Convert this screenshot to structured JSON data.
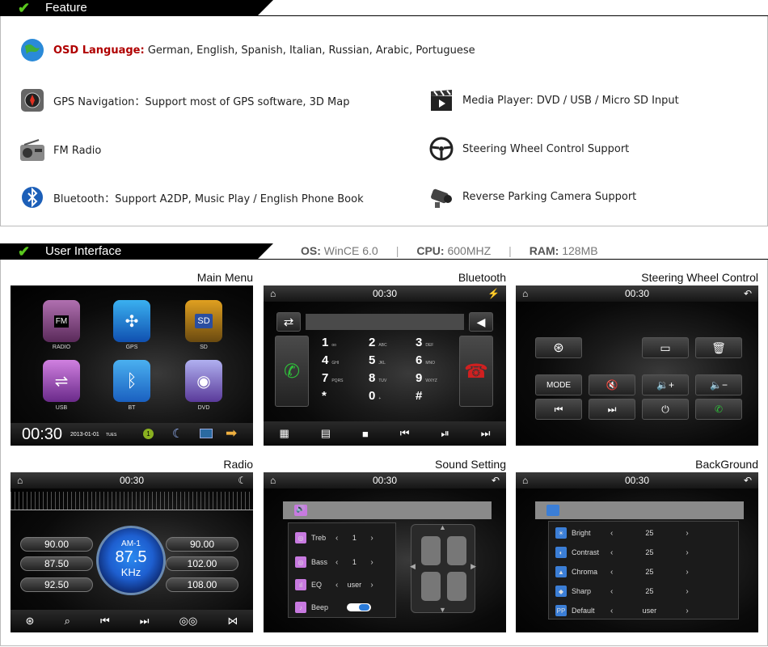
{
  "feature": {
    "title": "Feature",
    "items": {
      "osd_label": "OSD Language:",
      "osd_value": " German, English, Spanish, Italian, Russian, Arabic, Portuguese",
      "gps": "GPS Navigation：Support most of GPS software, 3D Map",
      "media": "Media Player: DVD / USB / Micro SD Input",
      "fm": "FM Radio",
      "swc": "Steering Wheel Control Support",
      "bt": "Bluetooth：Support A2DP, Music Play / English Phone Book",
      "cam": "Reverse Parking Camera Support"
    }
  },
  "ui": {
    "title": "User Interface",
    "os_label": "OS:",
    "os_value": "WinCE 6.0",
    "cpu_label": "CPU:",
    "cpu_value": "600MHZ",
    "ram_label": "RAM:",
    "ram_value": "128MB",
    "sep": "|"
  },
  "screens": {
    "main_menu": {
      "caption": "Main Menu",
      "apps": [
        "RADIO",
        "GPS",
        "SD",
        "USB",
        "BT",
        "DVD"
      ],
      "clock": "00:30",
      "date": "2013-01-01",
      "day": "TUES",
      "badge": "1"
    },
    "bluetooth": {
      "caption": "Bluetooth",
      "time": "00:30",
      "keys": [
        {
          "d": "1",
          "s": "oo"
        },
        {
          "d": "2",
          "s": "ABC"
        },
        {
          "d": "3",
          "s": "DEF"
        },
        {
          "d": "4",
          "s": "GHI"
        },
        {
          "d": "5",
          "s": "JKL"
        },
        {
          "d": "6",
          "s": "MNO"
        },
        {
          "d": "7",
          "s": "PQRS"
        },
        {
          "d": "8",
          "s": "TUV"
        },
        {
          "d": "9",
          "s": "WXYZ"
        },
        {
          "d": "*",
          "s": ""
        },
        {
          "d": "0",
          "s": "+"
        },
        {
          "d": "#",
          "s": ""
        }
      ]
    },
    "swc": {
      "caption": "Steering Wheel Control",
      "time": "00:30",
      "mode": "MODE"
    },
    "radio": {
      "caption": "Radio",
      "time": "00:30",
      "band": "AM-1",
      "freq": "87.5",
      "unit": "KHz",
      "left_presets": [
        "90.00",
        "87.50",
        "92.50"
      ],
      "right_presets": [
        "90.00",
        "102.00",
        "108.00"
      ]
    },
    "sound": {
      "caption": "Sound Setting",
      "time": "00:30",
      "rows": [
        {
          "label": "Treb",
          "value": "1"
        },
        {
          "label": "Bass",
          "value": "1"
        },
        {
          "label": "EQ",
          "value": "user"
        },
        {
          "label": "Beep",
          "value": ""
        }
      ]
    },
    "background": {
      "caption": "BackGround",
      "time": "00:30",
      "rows": [
        {
          "label": "Bright",
          "value": "25"
        },
        {
          "label": "Contrast",
          "value": "25"
        },
        {
          "label": "Chroma",
          "value": "25"
        },
        {
          "label": "Sharp",
          "value": "25"
        },
        {
          "label": "Default",
          "value": "user"
        }
      ],
      "default_icon": "PP"
    }
  },
  "icons": {
    "home": "⌂",
    "back": "↶",
    "moon": "☾",
    "arrow_left": "◀",
    "arrow_right": "▶",
    "less": "‹",
    "more": "›"
  },
  "colors": {
    "accent_green": "#5ac81e",
    "highlight_red": "#b00000",
    "call_green": "#2fbf3a",
    "hangup_red": "#d02020",
    "knob_blue": "#1e5fd0"
  }
}
